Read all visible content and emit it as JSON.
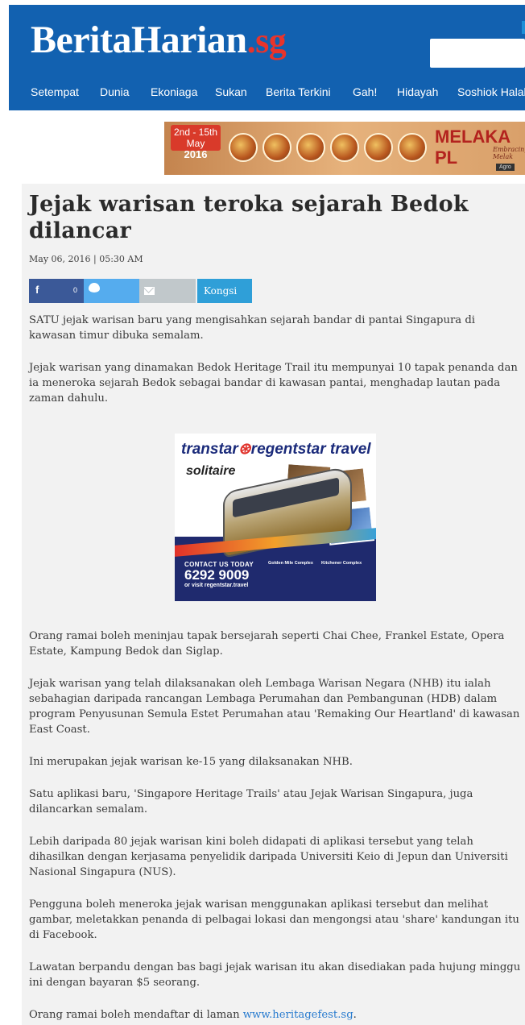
{
  "header": {
    "logo_main": "BeritaHarian",
    "logo_suffix": ".sg",
    "nav": [
      "Setempat",
      "Dunia",
      "Ekoniaga",
      "Sukan",
      "Berita Terkini",
      "Gah!",
      "Hidayah",
      "Soshiok Halal"
    ]
  },
  "banner": {
    "date_line1": "2nd - 15th May",
    "date_line2": "2016",
    "title": "MELAKA PL",
    "subtitle": "Embracing Melak",
    "tag": "Agro"
  },
  "article": {
    "title": "Jejak warisan teroka sejarah Bedok dilancar",
    "date": "May 06, 2016 | 05:30 AM",
    "share": {
      "fb_icon": "f",
      "fb_count": "0",
      "kongsi_label": "Kongsi"
    },
    "paragraphs": [
      "SATU jejak warisan baru yang mengisahkan sejarah bandar di pantai Singapura di kawasan timur dibuka semalam.",
      "Jejak warisan yang dinamakan Bedok Heritage Trail itu mempunyai 10 tapak penanda dan ia meneroka sejarah Bedok sebagai bandar di kawasan pantai, menghadap lautan pada zaman dahulu.",
      "Orang ramai boleh meninjau tapak bersejarah seperti Chai Chee, Frankel Estate, Opera Estate, Kampung Bedok dan Siglap.",
      "Jejak warisan yang telah dilaksanakan oleh Lembaga Warisan Negara (NHB) itu ialah sebahagian daripada rancangan Lembaga Perumahan dan Pembangunan (HDB) dalam program Penyusunan Semula Estet Perumahan atau 'Remaking Our Heartland' di kawasan East Coast.",
      "Ini merupakan jejak warisan ke-15 yang dilaksanakan NHB.",
      "Satu aplikasi baru, 'Singapore Heritage Trails' atau Jejak Warisan Singapura, juga dilancarkan semalam.",
      "Lebih daripada 80 jejak warisan kini boleh didapati di aplikasi tersebut yang telah dihasilkan dengan kerjasama penyelidik daripada Universiti Keio di Jepun dan Universiti Nasional Singapura (NUS).",
      "Pengguna boleh meneroka jejak warisan menggunakan aplikasi tersebut dan melihat gambar, meletakkan penanda di pelbagai lokasi dan mengongsi atau 'share' kandungan itu di Facebook.",
      "Lawatan berpandu dengan bas bagi jejak warisan itu akan disediakan pada hujung minggu ini dengan bayaran $5 seorang."
    ],
    "last_paragraph_prefix": "Orang ramai boleh mendaftar di laman ",
    "last_paragraph_link": "www.heritagefest.sg",
    "last_paragraph_suffix": "."
  },
  "ad": {
    "brand_left": "transtar",
    "brand_right": "regentstar travel",
    "solitaire": "solitaire",
    "contact_label": "CONTACT US TODAY",
    "phone": "6292 9009",
    "web": "or visit regentstar.travel",
    "addr1_title": "Golden Mile Complex",
    "addr2_title": "Kitchener Complex"
  }
}
